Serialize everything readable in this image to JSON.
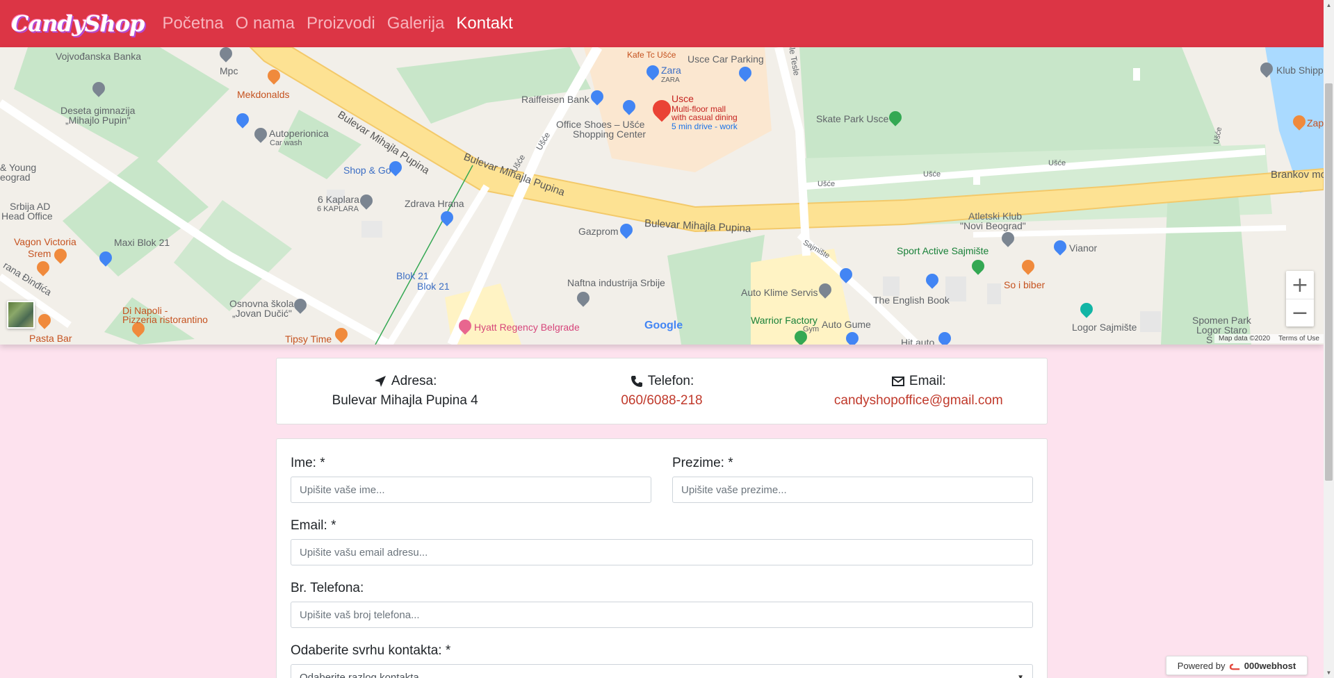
{
  "navbar": {
    "brand": "CandyShop",
    "links": [
      {
        "label": "Početna",
        "active": false
      },
      {
        "label": "O nama",
        "active": false
      },
      {
        "label": "Proizvodi",
        "active": false
      },
      {
        "label": "Galerija",
        "active": false
      },
      {
        "label": "Kontakt",
        "active": true
      }
    ]
  },
  "map": {
    "labels": {
      "vojvodjanska": "Vojvođanska Banka",
      "mpc": "Mpc",
      "mekdonalds": "Mekdonalds",
      "gimnazija1": "Deseta gimnazija",
      "gimnazija2": "„Mihajlo Pupin\"",
      "autoperionica": "Autoperionica",
      "carwash": "Car wash",
      "young": "& Young",
      "eograd": "eograd",
      "srbija_ad": "Srbija AD",
      "head_office": "Head Office",
      "vagon": "Vagon Victoria",
      "srem": "Srem",
      "maxi": "Maxi Blok 21",
      "dindica": "rana Đinđića",
      "di_napoli1": "Di Napoli -",
      "di_napoli2": "Pizzeria ristorantino",
      "pasta_bar": "Pasta Bar",
      "osnovna1": "Osnovna škola",
      "osnovna2": "„Jovan Dučić\"",
      "tipsy": "Tipsy Time",
      "kaplara1": "6 Kaplara",
      "kaplara2": "6 KAPLARA",
      "shopgo": "Shop & Go",
      "zdrava": "Zdrava Hrana",
      "blok21a": "Blok 21",
      "blok21b": "Blok 21",
      "bulevar1": "Bulevar Mihajla Pupina",
      "bulevar2": "Bulevar Mihajla Pupina",
      "bulevar3": "Bulevar Mihajla Pupina",
      "usce_road1": "Ušće",
      "usce_road2": "Ušće",
      "kafe": "Kafe Tc Ušće",
      "zara": "Zara",
      "zara2": "ZARA",
      "raiffeisen": "Raiffeisen Bank",
      "office_shoes1": "Office Shoes – Ušće",
      "office_shoes2": "Shopping Center",
      "usce_mall": "Usce",
      "usce_desc1": "Multi-floor mall",
      "usce_desc2": "with casual dining",
      "usce_desc3": "5 min drive - work",
      "usce_parking": "Usce Car Parking",
      "gazprom": "Gazprom",
      "naftna": "Naftna industrija Srbije",
      "hyatt": "Hyatt Regency Belgrade",
      "tesle": "ole Tesle",
      "skate": "Skate Park Usce",
      "usce_r3": "Ušće",
      "usce_r4": "Ušće",
      "usce_r5": "Ušće",
      "usce_r6": "Ušće",
      "brankov": "Brankov mo",
      "atletski1": "Atletski Klub",
      "atletski2": "\"Novi Beograd\"",
      "sajmiste_road": "Sajmište",
      "sport_active": "Sport Active Sajmište",
      "vianor": "Vianor",
      "so_i_biber": "So i biber",
      "auto_klime": "Auto Klime Servis",
      "english_book": "The English Book",
      "warrior1": "Warrior Factory",
      "warrior2": "Gym",
      "auto_gume": "Auto Gume",
      "hit_auto": "Hit auto",
      "logor": "Logor Sajmište",
      "spomen1": "Spomen Park",
      "spomen2": "Logor Staro",
      "spomen3": "S",
      "klub_ship": "Klub Shipp",
      "zap": "Zap",
      "google": "Google",
      "map_data": "Map data ©2020",
      "terms": "Terms of Use"
    },
    "zoom_in": "+",
    "zoom_out": "−"
  },
  "contact_info": {
    "address_label": "Adresa:",
    "address_value": "Bulevar Mihajla Pupina 4",
    "phone_label": "Telefon:",
    "phone_value": "060/6088-218",
    "email_label": "Email:",
    "email_value": "candyshopoffice@gmail.com"
  },
  "form": {
    "first_name_label": "Ime: *",
    "first_name_placeholder": "Upišite vaše ime...",
    "last_name_label": "Prezime: *",
    "last_name_placeholder": "Upišite vaše prezime...",
    "email_label": "Email: *",
    "email_placeholder": "Upišite vašu email adresu...",
    "phone_label": "Br. Telefona:",
    "phone_placeholder": "Upišite vaš broj telefona...",
    "purpose_label": "Odaberite svrhu kontakta: *",
    "purpose_selected": "Odaberite razlog kontakta"
  },
  "badge": {
    "powered_by": "Powered by",
    "brand": "000webhost"
  },
  "colors": {
    "navbar": "#dc3545",
    "page_bg": "#fde2ee",
    "link": "#c0392b"
  }
}
